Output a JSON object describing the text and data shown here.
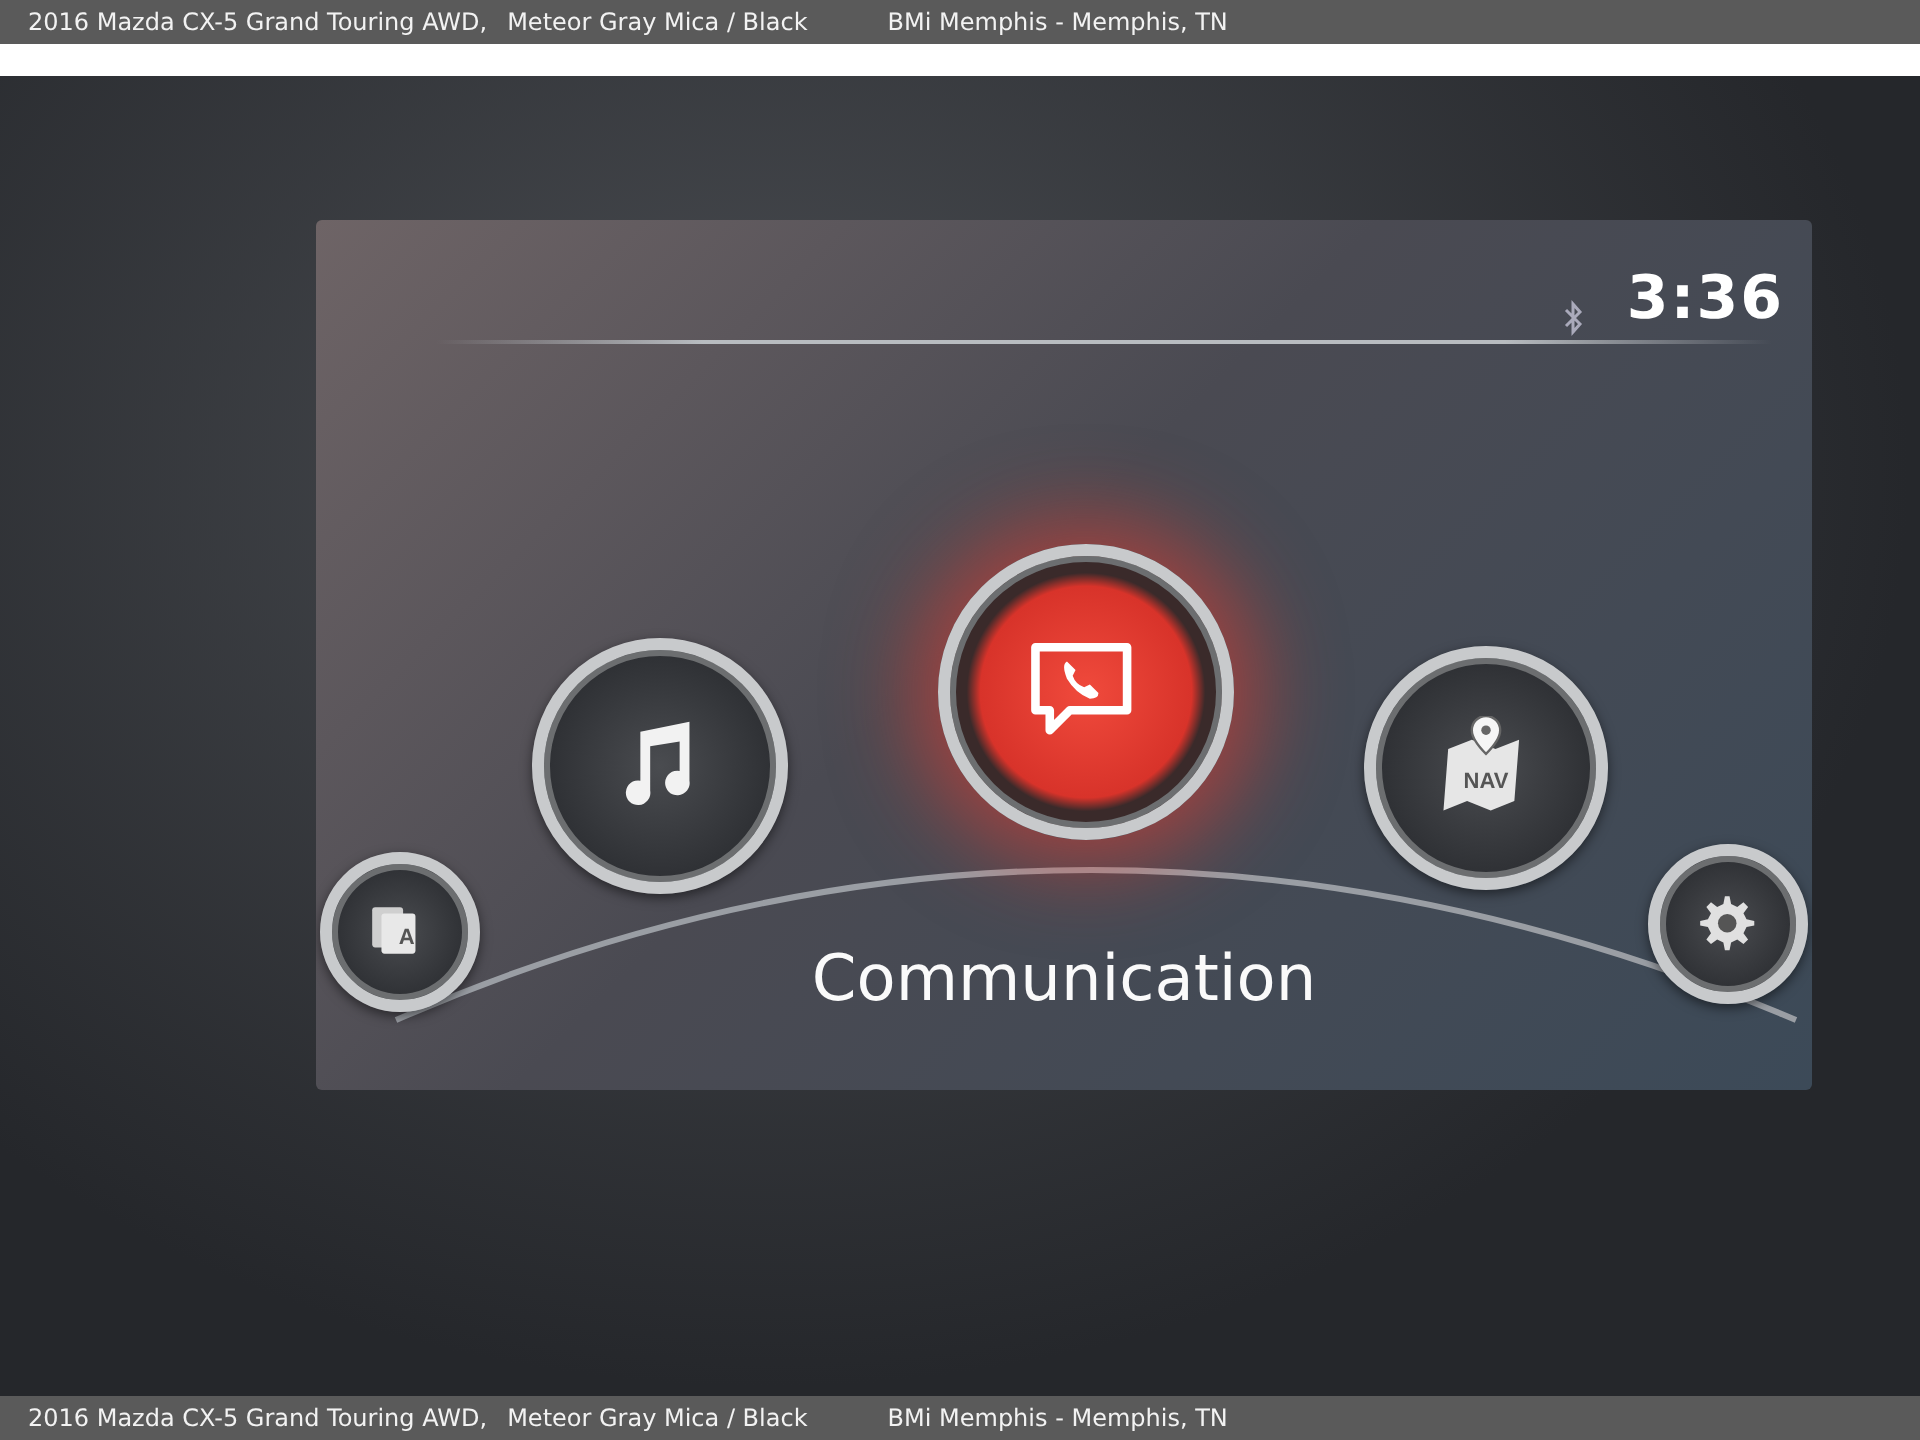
{
  "header": {
    "vehicle": "2016 Mazda CX-5 Grand Touring AWD,",
    "paint": "Meteor Gray Mica / Black",
    "dealer": "BMi Memphis - Memphis, TN"
  },
  "screen": {
    "time": "3:36",
    "caption": "Communication",
    "items": [
      {
        "kind": "apps",
        "label": "A",
        "selected": false
      },
      {
        "kind": "music",
        "selected": false
      },
      {
        "kind": "communication",
        "selected": true
      },
      {
        "kind": "navigation",
        "label": "NAV",
        "selected": false
      },
      {
        "kind": "settings",
        "selected": false
      }
    ]
  },
  "footer": {
    "vehicle": "2016 Mazda CX-5 Grand Touring AWD,",
    "paint": "Meteor Gray Mica / Black",
    "dealer": "BMi Memphis - Memphis, TN"
  }
}
